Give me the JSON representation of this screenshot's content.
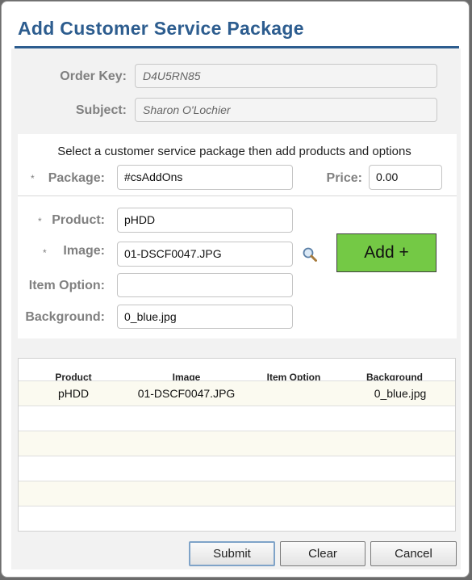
{
  "dialog": {
    "title": "Add Customer Service Package"
  },
  "order": {
    "order_key_label": "Order Key:",
    "order_key_value": "D4U5RN85",
    "subject_label": "Subject:",
    "subject_value": "Sharon O'Lochier"
  },
  "package_form": {
    "instructions": "Select a customer service package then add products and options",
    "package_label": "Package:",
    "package_value": "#csAddOns",
    "price_label": "Price:",
    "price_value": "0.00",
    "required_marker": "*"
  },
  "product_form": {
    "product_label": "Product:",
    "product_value": "pHDD",
    "image_label": "Image:",
    "image_value": "01-DSCF0047.JPG",
    "item_option_label": "Item Option:",
    "item_option_value": "",
    "background_label": "Background:",
    "background_value": "0_blue.jpg",
    "add_button": "Add +",
    "search_icon": "magnifier-icon"
  },
  "grid": {
    "columns": [
      "Product",
      "Image",
      "Item Option",
      "Background"
    ],
    "rows": [
      {
        "product": "pHDD",
        "image": "01-DSCF0047.JPG",
        "item_option": "",
        "background": "0_blue.jpg"
      }
    ]
  },
  "buttons": {
    "submit": "Submit",
    "clear": "Clear",
    "cancel": "Cancel"
  },
  "colors": {
    "accent": "#2d5d8f",
    "add_button": "#74c945",
    "alt_row": "#fbfaf0"
  }
}
